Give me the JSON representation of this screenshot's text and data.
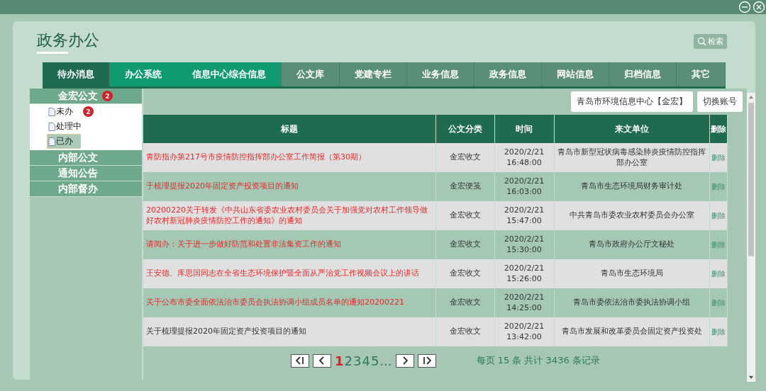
{
  "window": {
    "title": "政务办公",
    "search_label": "检索"
  },
  "tabs": [
    {
      "label": "待办消息",
      "selected": true,
      "highlighted": false
    },
    {
      "label": "办公系统",
      "selected": false,
      "highlighted": true
    },
    {
      "label": "信息中心综合信息",
      "selected": false,
      "highlighted": true
    },
    {
      "label": "公文库",
      "selected": false,
      "highlighted": false
    },
    {
      "label": "党建专栏",
      "selected": false,
      "highlighted": false
    },
    {
      "label": "业务信息",
      "selected": false,
      "highlighted": false
    },
    {
      "label": "政务信息",
      "selected": false,
      "highlighted": false
    },
    {
      "label": "网站信息",
      "selected": false,
      "highlighted": false
    },
    {
      "label": "归档信息",
      "selected": false,
      "highlighted": false
    },
    {
      "label": "其它",
      "selected": false,
      "highlighted": false
    }
  ],
  "sidebar": {
    "groups": [
      {
        "label": "金宏公文",
        "badge": "2",
        "children": [
          {
            "label": "未办",
            "badge": "2",
            "selected": false
          },
          {
            "label": "处理中",
            "selected": false
          },
          {
            "label": "已办",
            "selected": true
          }
        ]
      },
      {
        "label": "内部公文"
      },
      {
        "label": "通知公告"
      },
      {
        "label": "内部督办"
      }
    ]
  },
  "account": {
    "name": "青岛市环境信息中心【金宏】",
    "switch_label": "切换账号"
  },
  "table": {
    "columns": [
      "标题",
      "公文分类",
      "时间",
      "来文单位",
      "删除"
    ],
    "rows": [
      {
        "title": "青防指办第217号市疫情防控指挥部办公室工作简报（第30期）",
        "unread": true,
        "category": "金宏收文",
        "date": "2020/2/21",
        "time": "16:48:00",
        "sender": "青岛市新型冠状病毒感染肺炎疫情防控指挥部办公室",
        "action": "删除"
      },
      {
        "title": "于梳理提报2020年固定资产投资项目的通知",
        "unread": true,
        "category": "金宏便笺",
        "date": "2020/2/21",
        "time": "16:03:00",
        "sender": "青岛市生态环境局财务审计处",
        "action": "删除"
      },
      {
        "title": "20200220关于转发《中共山东省委农业农村委员会关于加强党对农村工作领导做好农村新冠肺炎疫情防控工作的通知》的通知",
        "unread": true,
        "category": "金宏收文",
        "date": "2020/2/21",
        "time": "15:47:00",
        "sender": "中共青岛市委农业农村委员会办公室",
        "action": "删除"
      },
      {
        "title": "请阅办：关于进一步做好防范和处置非法集资工作的通知",
        "unread": true,
        "category": "金宏收文",
        "date": "2020/2/21",
        "time": "15:30:00",
        "sender": "青岛市政府办公厅文秘处",
        "action": "删除"
      },
      {
        "title": "王安德、库思国同志在全省生态环境保护暨全面从严治党工作视频会议上的讲话",
        "unread": true,
        "category": "金宏收文",
        "date": "2020/2/21",
        "time": "15:26:00",
        "sender": "青岛市生态环境局",
        "action": "删除"
      },
      {
        "title": "关于公布市委全面依法治市委员会执法协调小组成员名单的通知20200221",
        "unread": true,
        "category": "金宏收文",
        "date": "2020/2/21",
        "time": "14:25:00",
        "sender": "青岛市委依法治市委执法协调小组",
        "action": "删除"
      },
      {
        "title": "关于梳理提报2020年固定资产投资项目的通知",
        "unread": false,
        "category": "金宏收文",
        "date": "2020/2/21",
        "time": "13:42:00",
        "sender": "青岛市发展和改革委员会固定资产投资处",
        "action": "删除"
      }
    ]
  },
  "pagination": {
    "pages": [
      {
        "label": "1",
        "selected": true
      },
      {
        "label": "2",
        "selected": false
      },
      {
        "label": "3",
        "selected": false
      },
      {
        "label": "4",
        "selected": false
      },
      {
        "label": "5",
        "selected": false
      }
    ],
    "more": "...",
    "summary": "每页 15 条 共计 3436 条记录"
  }
}
